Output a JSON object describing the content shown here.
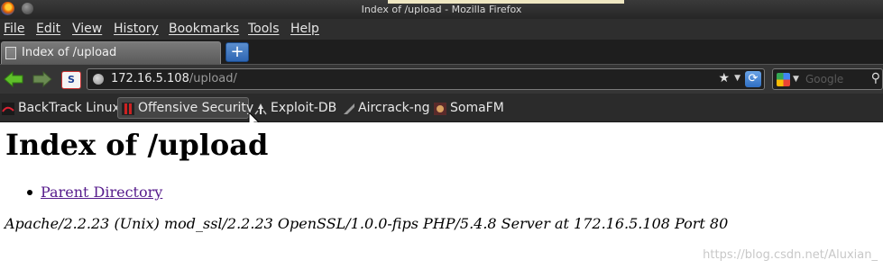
{
  "window": {
    "title": "Index of /upload - Mozilla Firefox"
  },
  "menu": {
    "file": "File",
    "edit": "Edit",
    "view": "View",
    "history": "History",
    "bookmarks": "Bookmarks",
    "tools": "Tools",
    "help": "Help"
  },
  "tab": {
    "label": "Index of /upload",
    "new_tab": "+"
  },
  "nav": {
    "url_host": "172.16.5.108",
    "url_path": "/upload/",
    "search_placeholder": "Google",
    "s_button": "S"
  },
  "bookmarks": [
    {
      "label": "BackTrack Linux",
      "icon": "backtrack-icon"
    },
    {
      "label": "Offensive Security",
      "icon": "offsec-icon"
    },
    {
      "label": "Exploit-DB",
      "icon": "exploitdb-icon"
    },
    {
      "label": "Aircrack-ng",
      "icon": "aircrack-icon"
    },
    {
      "label": "SomaFM",
      "icon": "somafm-icon"
    }
  ],
  "page": {
    "heading": "Index of /upload",
    "entries": [
      {
        "label": "Parent Directory"
      }
    ],
    "server_signature": "Apache/2.2.23 (Unix) mod_ssl/2.2.23 OpenSSL/1.0.0-fips PHP/5.4.8 Server at 172.16.5.108 Port 80"
  },
  "watermark": "https://blog.csdn.net/Aluxian_",
  "colors": {
    "visited_link": "#551a8b",
    "chrome_dark": "#2e2e2e"
  }
}
